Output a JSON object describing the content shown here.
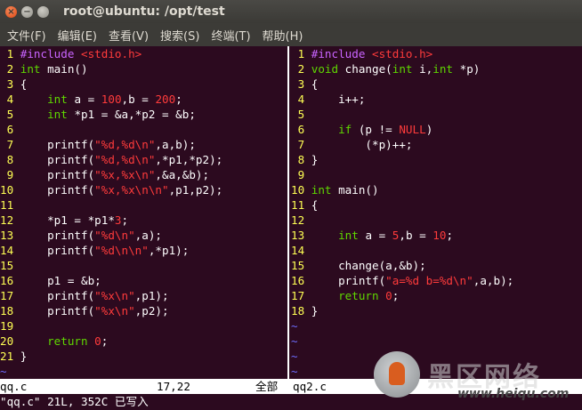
{
  "window": {
    "title": "root@ubuntu: /opt/test"
  },
  "menu": [
    "文件(F)",
    "编辑(E)",
    "查看(V)",
    "搜索(S)",
    "终端(T)",
    "帮助(H)"
  ],
  "left_pane": {
    "file": "qq.c",
    "cursor": "17,22",
    "scroll": "全部",
    "lines": [
      [
        [
          "ln",
          " 1 "
        ],
        [
          "p",
          "#include "
        ],
        [
          "s",
          "<stdio.h>"
        ]
      ],
      [
        [
          "ln",
          " 2 "
        ],
        [
          "k",
          "int"
        ],
        [
          "",
          "main()"
        ]
      ],
      [
        [
          "ln",
          " 3 "
        ],
        [
          "",
          "{"
        ]
      ],
      [
        [
          "ln",
          " 4 "
        ],
        [
          "",
          "    "
        ],
        [
          "k",
          "int"
        ],
        [
          "",
          "a = "
        ],
        [
          "n",
          "100"
        ],
        [
          "",
          ",b = "
        ],
        [
          "n",
          "200"
        ],
        [
          "",
          ";"
        ]
      ],
      [
        [
          "ln",
          " 5 "
        ],
        [
          "",
          "    "
        ],
        [
          "k",
          "int"
        ],
        [
          "",
          "*p1 = &a,*p2 = &b;"
        ]
      ],
      [
        [
          "ln",
          " 6 "
        ]
      ],
      [
        [
          "ln",
          " 7 "
        ],
        [
          "",
          "    printf("
        ],
        [
          "s",
          "\"%d,%d\\n\""
        ],
        [
          "",
          ",a,b);"
        ]
      ],
      [
        [
          "ln",
          " 8 "
        ],
        [
          "",
          "    printf("
        ],
        [
          "s",
          "\"%d,%d\\n\""
        ],
        [
          "",
          ",*p1,*p2);"
        ]
      ],
      [
        [
          "ln",
          " 9 "
        ],
        [
          "",
          "    printf("
        ],
        [
          "s",
          "\"%x,%x\\n\""
        ],
        [
          "",
          ",&a,&b);"
        ]
      ],
      [
        [
          "ln",
          "10 "
        ],
        [
          "",
          "    printf("
        ],
        [
          "s",
          "\"%x,%x\\n\\n\""
        ],
        [
          "",
          ",p1,p2);"
        ]
      ],
      [
        [
          "ln",
          "11 "
        ]
      ],
      [
        [
          "ln",
          "12 "
        ],
        [
          "",
          "    *p1 = *p1*"
        ],
        [
          "n",
          "3"
        ],
        [
          "",
          ";"
        ]
      ],
      [
        [
          "ln",
          "13 "
        ],
        [
          "",
          "    printf("
        ],
        [
          "s",
          "\"%d\\n\""
        ],
        [
          "",
          ",a);"
        ]
      ],
      [
        [
          "ln",
          "14 "
        ],
        [
          "",
          "    printf("
        ],
        [
          "s",
          "\"%d\\n\\n\""
        ],
        [
          "",
          ",*p1);"
        ]
      ],
      [
        [
          "ln",
          "15 "
        ]
      ],
      [
        [
          "ln",
          "16 "
        ],
        [
          "",
          "    p1 = &b;"
        ]
      ],
      [
        [
          "ln",
          "17 "
        ],
        [
          "",
          "    printf("
        ],
        [
          "s",
          "\"%x\\n\""
        ],
        [
          "",
          ",p1);"
        ]
      ],
      [
        [
          "ln",
          "18 "
        ],
        [
          "",
          "    printf("
        ],
        [
          "s",
          "\"%x\\n\""
        ],
        [
          "",
          ",p2);"
        ]
      ],
      [
        [
          "ln",
          "19 "
        ]
      ],
      [
        [
          "ln",
          "20 "
        ],
        [
          "",
          "    "
        ],
        [
          "k",
          "return"
        ],
        [
          "n",
          "0"
        ],
        [
          "",
          ";"
        ]
      ],
      [
        [
          "ln",
          "21 "
        ],
        [
          "",
          "}"
        ]
      ],
      [
        [
          "t",
          "~"
        ]
      ]
    ]
  },
  "right_pane": {
    "file": "qq2.c",
    "lines": [
      [
        [
          "ln",
          " 1 "
        ],
        [
          "p",
          "#include "
        ],
        [
          "s",
          "<stdio.h>"
        ]
      ],
      [
        [
          "ln",
          " 2 "
        ],
        [
          "k",
          "void"
        ],
        [
          "",
          "change("
        ],
        [
          "k",
          "int"
        ],
        [
          "",
          "i,"
        ],
        [
          "k",
          "int"
        ],
        [
          "",
          "*p)"
        ]
      ],
      [
        [
          "ln",
          " 3 "
        ],
        [
          "",
          "{"
        ]
      ],
      [
        [
          "ln",
          " 4 "
        ],
        [
          "",
          "    i++;"
        ]
      ],
      [
        [
          "ln",
          " 5 "
        ]
      ],
      [
        [
          "ln",
          " 6 "
        ],
        [
          "",
          "    "
        ],
        [
          "k",
          "if"
        ],
        [
          "",
          "(p != "
        ],
        [
          "n",
          "NULL"
        ],
        [
          "",
          ")"
        ]
      ],
      [
        [
          "ln",
          " 7 "
        ],
        [
          "",
          "        (*p)++;"
        ]
      ],
      [
        [
          "ln",
          " 8 "
        ],
        [
          "",
          "}"
        ]
      ],
      [
        [
          "ln",
          " 9 "
        ]
      ],
      [
        [
          "ln",
          "10 "
        ],
        [
          "k",
          "int"
        ],
        [
          "",
          "main()"
        ]
      ],
      [
        [
          "ln",
          "11 "
        ],
        [
          "",
          "{"
        ]
      ],
      [
        [
          "ln",
          "12 "
        ]
      ],
      [
        [
          "ln",
          "13 "
        ],
        [
          "",
          "    "
        ],
        [
          "k",
          "int"
        ],
        [
          "",
          "a = "
        ],
        [
          "n",
          "5"
        ],
        [
          "",
          ",b = "
        ],
        [
          "n",
          "10"
        ],
        [
          "",
          ";"
        ]
      ],
      [
        [
          "ln",
          "14 "
        ]
      ],
      [
        [
          "ln",
          "15 "
        ],
        [
          "",
          "    change(a,&b);"
        ]
      ],
      [
        [
          "ln",
          "16 "
        ],
        [
          "",
          "    printf("
        ],
        [
          "s",
          "\"a=%d b=%d\\n\""
        ],
        [
          "",
          ",a,b);"
        ]
      ],
      [
        [
          "ln",
          "17 "
        ],
        [
          "",
          "    "
        ],
        [
          "k",
          "return"
        ],
        [
          "n",
          "0"
        ],
        [
          "",
          ";"
        ]
      ],
      [
        [
          "ln",
          "18 "
        ],
        [
          "",
          "}"
        ]
      ],
      [
        [
          "t",
          "~"
        ]
      ],
      [
        [
          "t",
          "~"
        ]
      ],
      [
        [
          "t",
          "~"
        ]
      ],
      [
        [
          "t",
          "~"
        ]
      ]
    ]
  },
  "cmdline": "\"qq.c\" 21L, 352C 已写入",
  "watermark": {
    "cn": "黑区网络",
    "url": "www.heiqu.com"
  },
  "colors": {
    "background": "#2c0a1f",
    "line_number": "#ffff54",
    "keyword": "#5fd700",
    "string": "#ff3b3b",
    "preproc": "#c964ff",
    "tilde": "#6d6dff"
  }
}
